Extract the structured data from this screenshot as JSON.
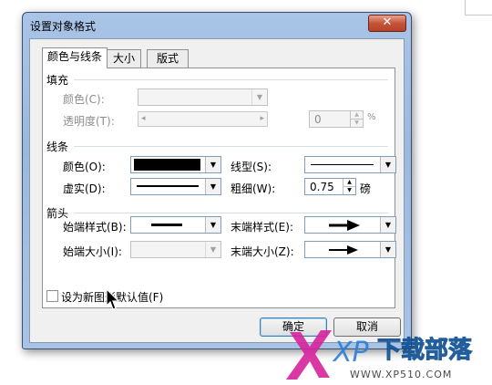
{
  "dialog": {
    "title": "设置对象格式",
    "close_glyph": "✕"
  },
  "tabs": [
    {
      "label": "颜色与线条",
      "active": true
    },
    {
      "label": "大小",
      "active": false
    },
    {
      "label": "版式",
      "active": false
    }
  ],
  "fill": {
    "section_title": "填充",
    "color_label": "颜色(C):",
    "transparency_label": "透明度(T):",
    "transparency_value": "0",
    "percent_sign": "%",
    "slider_left": "◂",
    "slider_right": "▸"
  },
  "line": {
    "section_title": "线条",
    "color_label": "颜色(O):",
    "color_value": "#000000",
    "style_label": "线型(S):",
    "dash_label": "虚实(D):",
    "weight_label": "粗细(W):",
    "weight_value": "0.75",
    "weight_unit": "磅"
  },
  "arrows": {
    "section_title": "箭头",
    "begin_style_label": "始端样式(B):",
    "end_style_label": "末端样式(E):",
    "begin_size_label": "始端大小(I):",
    "end_size_label": "末端大小(Z):"
  },
  "default_checkbox": {
    "label": "设为新图形默认值(F)",
    "checked": false
  },
  "buttons": {
    "ok": "确定",
    "cancel": "取消"
  },
  "combo_arrow": "▼",
  "spin_up": "▲",
  "spin_down": "▼",
  "watermark": {
    "brand_text": "下载部落",
    "url_text": "WWW.XP510.COM"
  }
}
